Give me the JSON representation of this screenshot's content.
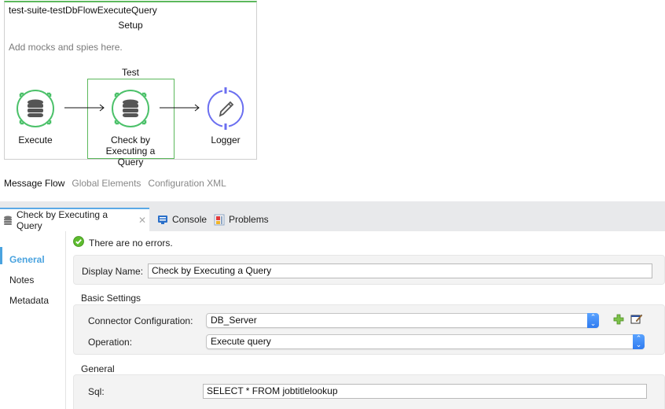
{
  "canvas": {
    "suite_title": "test-suite-testDbFlowExecuteQuery",
    "setup_title": "Setup",
    "setup_hint": "Add mocks and spies here.",
    "test_title": "Test",
    "nodes": [
      {
        "label_line1": "Execute",
        "label_line2": "",
        "icon": "database-icon",
        "color": "#4cc16a"
      },
      {
        "label_line1": "Check by",
        "label_line2": "Executing a Query",
        "icon": "database-icon",
        "color": "#4cc16a"
      },
      {
        "label_line1": "Logger",
        "label_line2": "",
        "icon": "pencil-icon",
        "color": "#6b6ff0"
      }
    ]
  },
  "editor_tabs": [
    "Message Flow",
    "Global Elements",
    "Configuration XML"
  ],
  "panel_tabs": [
    {
      "label": "Check by Executing a Query",
      "icon": "database-icon",
      "close": "✕"
    },
    {
      "label": "Console",
      "icon": "console-icon"
    },
    {
      "label": "Problems",
      "icon": "problems-icon"
    }
  ],
  "sidebar": {
    "items": [
      "General",
      "Notes",
      "Metadata"
    ],
    "active": "General"
  },
  "status": {
    "text": "There are no errors."
  },
  "form": {
    "display_name_label": "Display Name:",
    "display_name_value": "Check by Executing a Query",
    "basic_settings_title": "Basic Settings",
    "connector_config_label": "Connector Configuration:",
    "connector_config_value": "DB_Server",
    "operation_label": "Operation:",
    "operation_value": "Execute query",
    "general_title": "General",
    "sql_label": "Sql:",
    "sql_value": "SELECT * FROM jobtitlelookup"
  },
  "colors": {
    "accent": "#4aa3df",
    "flow_green": "#4cc16a",
    "logger_blue": "#6b6ff0",
    "select_blue": "#2f7bf0"
  }
}
